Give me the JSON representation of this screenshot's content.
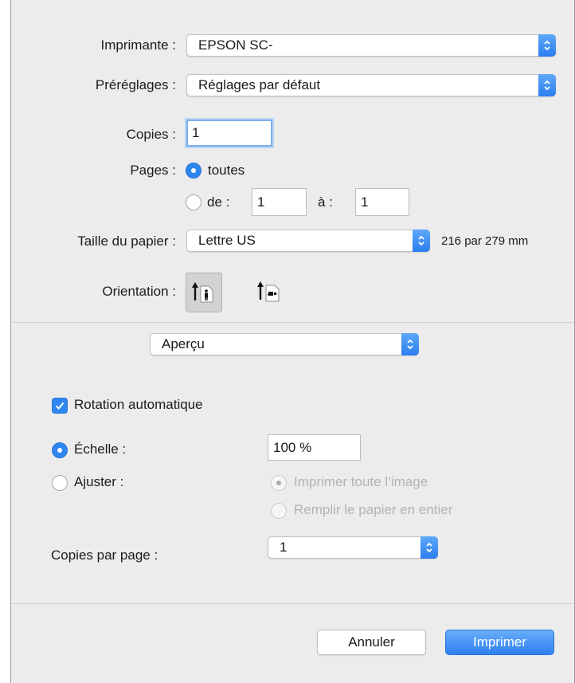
{
  "printer": {
    "label": "Imprimante :",
    "value": "EPSON SC-"
  },
  "presets": {
    "label": "Préréglages :",
    "value": "Réglages par défaut"
  },
  "copies": {
    "label": "Copies :",
    "value": "1"
  },
  "pages": {
    "label": "Pages :",
    "all_label": "toutes",
    "range_label": "de :",
    "from_value": "1",
    "to_label": "à :",
    "to_value": "1",
    "selected": "toutes"
  },
  "paper_size": {
    "label": "Taille du papier :",
    "value": "Lettre US",
    "dimensions": "216 par 279 mm"
  },
  "orientation": {
    "label": "Orientation :",
    "selected": "portrait",
    "icons": [
      "portrait-icon",
      "landscape-icon"
    ]
  },
  "section_popup": {
    "value": "Aperçu"
  },
  "preview": {
    "auto_rotate_label": "Rotation automatique",
    "auto_rotate_checked": true,
    "scale_label": "Échelle :",
    "scale_value": "100 %",
    "fit_label": "Ajuster :",
    "fit_selected": "scale",
    "fit_option_1": "Imprimer toute l’image",
    "fit_option_2": "Remplir le papier en entier",
    "copies_per_page_label": "Copies par page :",
    "copies_per_page_value": "1"
  },
  "buttons": {
    "cancel": "Annuler",
    "print": "Imprimer"
  },
  "colors": {
    "accent": "#2f86ee",
    "dialog_bg": "#ececec",
    "disabled_text": "#b3b3b3"
  }
}
